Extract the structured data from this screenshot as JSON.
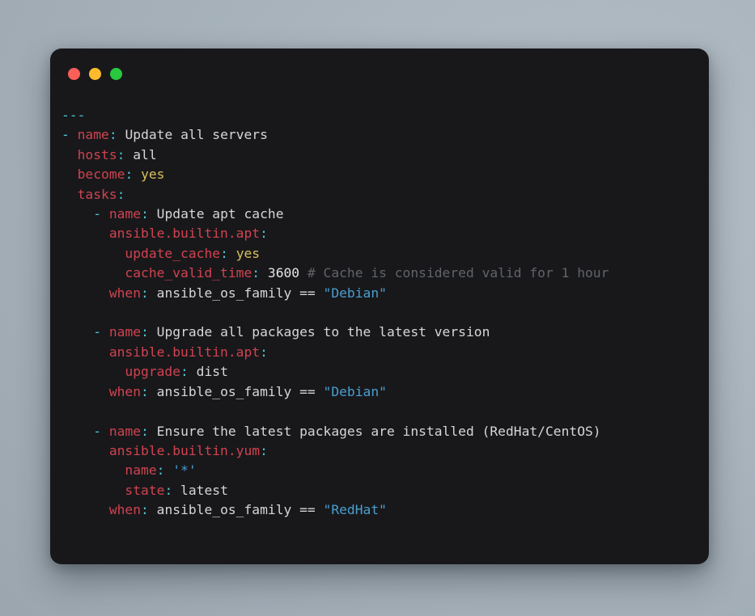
{
  "window": {
    "title": "",
    "traffic_lights": [
      {
        "name": "close-button",
        "color": "#fb5f57",
        "label": ""
      },
      {
        "name": "minimize-button",
        "color": "#fcbb2d",
        "label": ""
      },
      {
        "name": "zoom-button",
        "color": "#28c93f",
        "label": ""
      }
    ],
    "background_color": "#18181b",
    "desktop_color": "#a7b2bb"
  },
  "editor": {
    "language": "yaml",
    "theme_colors": {
      "punctuation": "#4ec7d4",
      "key": "#d0434f",
      "text": "#d6d6d6",
      "boolean": "#d8c05a",
      "number": "#e3e3e3",
      "string": "#4a9fd0",
      "comment": "#5f6468"
    },
    "lines": [
      {
        "id": "line-1",
        "tokens": [
          {
            "type": "punct",
            "text": "---"
          }
        ]
      },
      {
        "id": "line-2",
        "tokens": [
          {
            "type": "punct",
            "text": "-"
          },
          {
            "type": "text",
            "text": " "
          },
          {
            "type": "key",
            "text": "name"
          },
          {
            "type": "punct",
            "text": ":"
          },
          {
            "type": "text",
            "text": " Update all servers"
          }
        ]
      },
      {
        "id": "line-3",
        "tokens": [
          {
            "type": "text",
            "text": "  "
          },
          {
            "type": "key",
            "text": "hosts"
          },
          {
            "type": "punct",
            "text": ":"
          },
          {
            "type": "text",
            "text": " all"
          }
        ]
      },
      {
        "id": "line-4",
        "tokens": [
          {
            "type": "text",
            "text": "  "
          },
          {
            "type": "key",
            "text": "become"
          },
          {
            "type": "punct",
            "text": ":"
          },
          {
            "type": "text",
            "text": " "
          },
          {
            "type": "bool",
            "text": "yes"
          }
        ]
      },
      {
        "id": "line-5",
        "tokens": [
          {
            "type": "text",
            "text": "  "
          },
          {
            "type": "key",
            "text": "tasks"
          },
          {
            "type": "punct",
            "text": ":"
          }
        ]
      },
      {
        "id": "line-6",
        "tokens": [
          {
            "type": "text",
            "text": "    "
          },
          {
            "type": "punct",
            "text": "-"
          },
          {
            "type": "text",
            "text": " "
          },
          {
            "type": "key",
            "text": "name"
          },
          {
            "type": "punct",
            "text": ":"
          },
          {
            "type": "text",
            "text": " Update apt cache"
          }
        ]
      },
      {
        "id": "line-7",
        "tokens": [
          {
            "type": "text",
            "text": "      "
          },
          {
            "type": "key",
            "text": "ansible.builtin.apt"
          },
          {
            "type": "punct",
            "text": ":"
          }
        ]
      },
      {
        "id": "line-8",
        "tokens": [
          {
            "type": "text",
            "text": "        "
          },
          {
            "type": "key",
            "text": "update_cache"
          },
          {
            "type": "punct",
            "text": ":"
          },
          {
            "type": "text",
            "text": " "
          },
          {
            "type": "bool",
            "text": "yes"
          }
        ]
      },
      {
        "id": "line-9",
        "tokens": [
          {
            "type": "text",
            "text": "        "
          },
          {
            "type": "key",
            "text": "cache_valid_time"
          },
          {
            "type": "punct",
            "text": ":"
          },
          {
            "type": "text",
            "text": " "
          },
          {
            "type": "num",
            "text": "3600"
          },
          {
            "type": "text",
            "text": " "
          },
          {
            "type": "comment",
            "text": "# Cache is considered valid for 1 hour"
          }
        ]
      },
      {
        "id": "line-10",
        "tokens": [
          {
            "type": "text",
            "text": "      "
          },
          {
            "type": "key",
            "text": "when"
          },
          {
            "type": "punct",
            "text": ":"
          },
          {
            "type": "text",
            "text": " ansible_os_family == "
          },
          {
            "type": "str",
            "text": "\"Debian\""
          }
        ]
      },
      {
        "id": "line-11",
        "tokens": []
      },
      {
        "id": "line-12",
        "tokens": [
          {
            "type": "text",
            "text": "    "
          },
          {
            "type": "punct",
            "text": "-"
          },
          {
            "type": "text",
            "text": " "
          },
          {
            "type": "key",
            "text": "name"
          },
          {
            "type": "punct",
            "text": ":"
          },
          {
            "type": "text",
            "text": " Upgrade all packages to the latest version"
          }
        ]
      },
      {
        "id": "line-13",
        "tokens": [
          {
            "type": "text",
            "text": "      "
          },
          {
            "type": "key",
            "text": "ansible.builtin.apt"
          },
          {
            "type": "punct",
            "text": ":"
          }
        ]
      },
      {
        "id": "line-14",
        "tokens": [
          {
            "type": "text",
            "text": "        "
          },
          {
            "type": "key",
            "text": "upgrade"
          },
          {
            "type": "punct",
            "text": ":"
          },
          {
            "type": "text",
            "text": " dist"
          }
        ]
      },
      {
        "id": "line-15",
        "tokens": [
          {
            "type": "text",
            "text": "      "
          },
          {
            "type": "key",
            "text": "when"
          },
          {
            "type": "punct",
            "text": ":"
          },
          {
            "type": "text",
            "text": " ansible_os_family == "
          },
          {
            "type": "str",
            "text": "\"Debian\""
          }
        ]
      },
      {
        "id": "line-16",
        "tokens": []
      },
      {
        "id": "line-17",
        "tokens": [
          {
            "type": "text",
            "text": "    "
          },
          {
            "type": "punct",
            "text": "-"
          },
          {
            "type": "text",
            "text": " "
          },
          {
            "type": "key",
            "text": "name"
          },
          {
            "type": "punct",
            "text": ":"
          },
          {
            "type": "text",
            "text": " Ensure the latest packages are installed (RedHat/CentOS)"
          }
        ]
      },
      {
        "id": "line-18",
        "tokens": [
          {
            "type": "text",
            "text": "      "
          },
          {
            "type": "key",
            "text": "ansible.builtin.yum"
          },
          {
            "type": "punct",
            "text": ":"
          }
        ]
      },
      {
        "id": "line-19",
        "tokens": [
          {
            "type": "text",
            "text": "        "
          },
          {
            "type": "key",
            "text": "name"
          },
          {
            "type": "punct",
            "text": ":"
          },
          {
            "type": "text",
            "text": " "
          },
          {
            "type": "str",
            "text": "'*'"
          }
        ]
      },
      {
        "id": "line-20",
        "tokens": [
          {
            "type": "text",
            "text": "        "
          },
          {
            "type": "key",
            "text": "state"
          },
          {
            "type": "punct",
            "text": ":"
          },
          {
            "type": "text",
            "text": " latest"
          }
        ]
      },
      {
        "id": "line-21",
        "tokens": [
          {
            "type": "text",
            "text": "      "
          },
          {
            "type": "key",
            "text": "when"
          },
          {
            "type": "punct",
            "text": ":"
          },
          {
            "type": "text",
            "text": " ansible_os_family == "
          },
          {
            "type": "str",
            "text": "\"RedHat\""
          }
        ]
      }
    ]
  }
}
